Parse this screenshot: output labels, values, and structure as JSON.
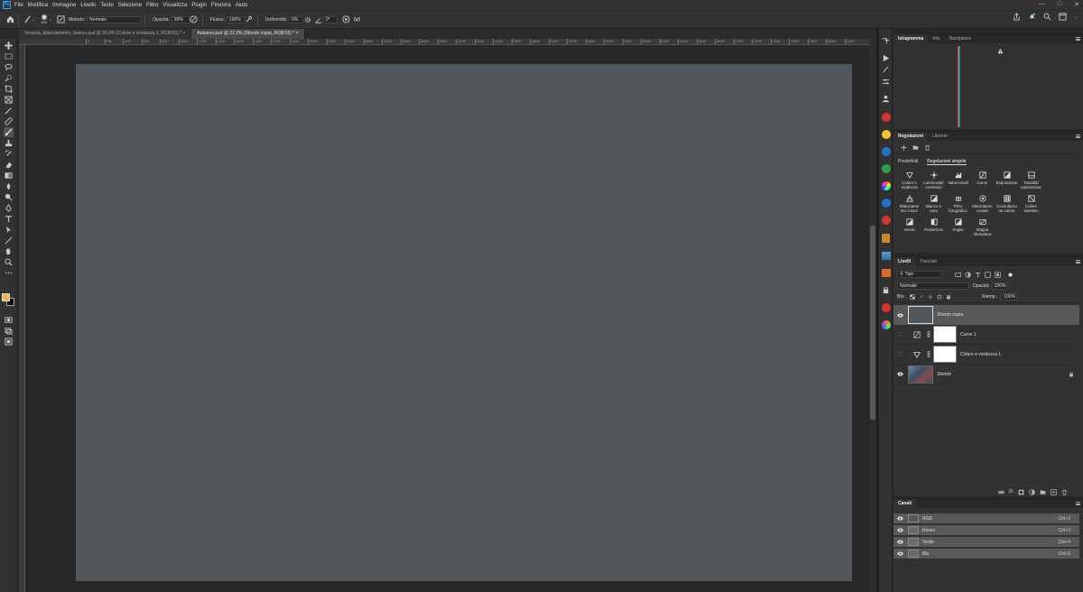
{
  "menu": [
    "File",
    "Modifica",
    "Immagine",
    "Livello",
    "Testo",
    "Selezione",
    "Filtro",
    "Visualizza",
    "Plugin",
    "Finestra",
    "Aiuto"
  ],
  "options": {
    "brush_size": "300",
    "mode_label": "Metodo:",
    "mode_value": "Normale",
    "opacity_label": "Opacità:",
    "opacity_value": "30%",
    "flow_label": "Flusso:",
    "flow_value": "100%",
    "smoothing_label": "Uniformità:",
    "smoothing_value": "0%",
    "angle_value": "0°"
  },
  "tabs": [
    {
      "label": "Venezia_bilanciamento_bianco.psd @ 26,8% (Colore e vividezza 1, RGB/16) *"
    },
    {
      "label": "Autunno.psd @ 22,2% (Sfondo copia, RGB/16) *"
    }
  ],
  "ruler_ticks": [
    "0",
    "200",
    "400",
    "600",
    "800",
    "1000",
    "1200",
    "1400",
    "1600",
    "1800",
    "2000",
    "2200",
    "2400",
    "2600",
    "2800",
    "3000",
    "3200",
    "3400",
    "3600",
    "3800",
    "4000",
    "4200",
    "4400",
    "4600",
    "4800",
    "5000",
    "5200",
    "5400",
    "5600",
    "5800",
    "6000",
    "6200",
    "6400",
    "6600",
    "6800",
    "7000",
    "7200",
    "7400",
    "7600",
    "7800",
    "8000",
    "8200"
  ],
  "histogram_panel": {
    "tabs": [
      "Istogramma",
      "Info",
      "Navigatore"
    ]
  },
  "adjustments_panel": {
    "tabs": [
      "Regolazioni",
      "Librerie"
    ],
    "subtabs": [
      "Predefiniti",
      "Regolazioni singole"
    ],
    "items": [
      "Colore e vividezza",
      "Luminosità/ contrasto",
      "Valori tonali",
      "Curve",
      "Esposizione",
      "Tonalità/ saturazione",
      "Bilanciame nto colore",
      "Bianco e nero",
      "Filtro fotografico",
      "Miscelatore canale",
      "Consultazio ne colore",
      "Colore selettivo",
      "Inverti",
      "Posterizza",
      "Soglia",
      "Mappa sfumatura"
    ]
  },
  "layers_panel": {
    "tabs": [
      "Livelli",
      "Tracciati"
    ],
    "filter_value": "Tipo",
    "blend_mode": "Normale",
    "opacity_label": "Opacità:",
    "opacity_value": "100%",
    "lock_label": "Blo.:",
    "fill_label": "Riemp.:",
    "fill_value": "100%",
    "layers": [
      {
        "name": "Sfondo copia"
      },
      {
        "name": "Curve 1"
      },
      {
        "name": "Colore e vividezza 1"
      },
      {
        "name": "Sfondo"
      }
    ]
  },
  "channels_panel": {
    "tabs": [
      "Canali"
    ],
    "channels": [
      {
        "name": "RGB",
        "shortcut": "Ctrl+2"
      },
      {
        "name": "Rosso",
        "shortcut": "Ctrl+3"
      },
      {
        "name": "Verde",
        "shortcut": "Ctrl+4"
      },
      {
        "name": "Blu",
        "shortcut": "Ctrl+5"
      }
    ]
  },
  "colors": {
    "canvas": "#52575c",
    "foreground": "#f0b35a",
    "background": "#000000"
  }
}
